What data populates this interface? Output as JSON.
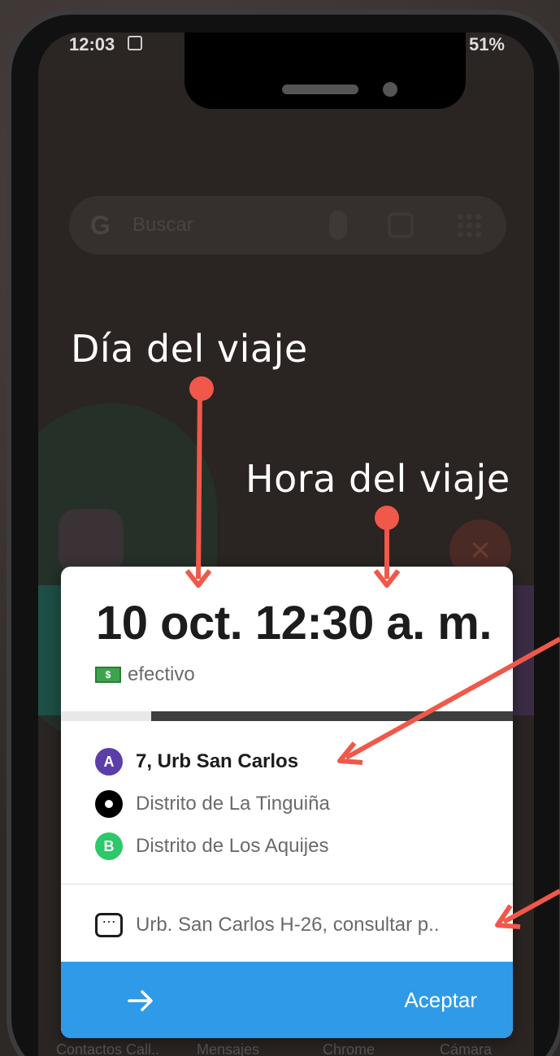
{
  "status_bar": {
    "time": "12:03",
    "battery": "51%"
  },
  "home_screen": {
    "search_placeholder": "Buscar",
    "dock_labels": [
      "Contactos Call..",
      "Mensajes",
      "Chrome",
      "Cámara"
    ]
  },
  "annotations": {
    "day_label": "Día del viaje",
    "time_label": "Hora del viaje",
    "color": "#f0584a"
  },
  "trip_card": {
    "datetime": "10 oct. 12:30 a. m.",
    "payment_icon": "$",
    "payment_method": "efectivo",
    "progress": 0.2,
    "stops": [
      {
        "badge": "A",
        "label": "7, Urb San Carlos",
        "color": "#5b3ea8"
      },
      {
        "badge": "",
        "label": "Distrito de La Tinguiña",
        "color": "#000000"
      },
      {
        "badge": "B",
        "label": "Distrito de Los Aquijes",
        "color": "#2dc86a"
      }
    ],
    "comment": "Urb. San Carlos H-26, consultar p..",
    "accept_label": "Aceptar",
    "accept_color": "#2f9ae8"
  }
}
